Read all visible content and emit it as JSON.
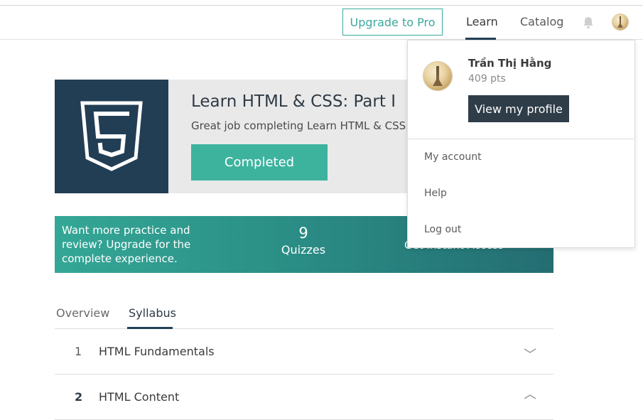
{
  "header": {
    "upgrade_label": "Upgrade to Pro",
    "nav": [
      {
        "label": "Learn",
        "active": true
      },
      {
        "label": "Catalog",
        "active": false
      }
    ],
    "accent_color": "#3aa99d"
  },
  "course": {
    "title": "Learn HTML & CSS: Part I",
    "subtitle": "Great job completing Learn HTML & CSS: Pa",
    "status_label": "Completed",
    "logo_icon": "html5-icon",
    "logo_bg": "#223e55",
    "status_color": "#3db39e"
  },
  "promo": {
    "text": "Want more practice and review? Upgrade for the complete experience.",
    "stat_value": "9",
    "stat_label": "Quizzes",
    "cta": "Get Instant Access »"
  },
  "tabs": [
    {
      "label": "Overview",
      "active": false
    },
    {
      "label": "Syllabus",
      "active": true
    }
  ],
  "syllabus": [
    {
      "num": "1",
      "title": "HTML Fundamentals",
      "expanded": false
    },
    {
      "num": "2",
      "title": "HTML Content",
      "expanded": true
    }
  ],
  "user_menu": {
    "name": "Trần Thị Hằng",
    "points": "409 pts",
    "profile_button": "View my profile",
    "items": [
      "My account",
      "Help",
      "Log out"
    ]
  }
}
